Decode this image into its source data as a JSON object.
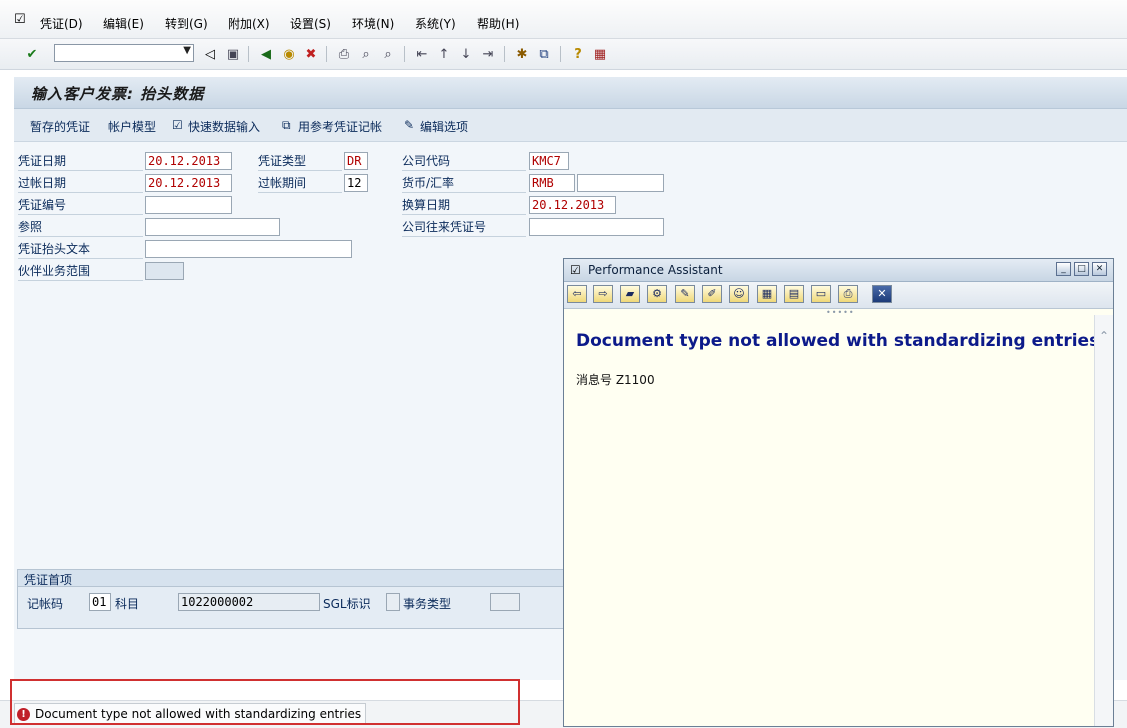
{
  "menu": {
    "items": [
      "凭证(D)",
      "编辑(E)",
      "转到(G)",
      "附加(X)",
      "设置(S)",
      "环境(N)",
      "系统(Y)",
      "帮助(H)"
    ]
  },
  "header": {
    "title": "输入客户发票: 抬头数据"
  },
  "app_toolbar": {
    "parked": "暂存的凭证",
    "acct_model": "帐户模型",
    "fast_entry": "快速数据输入",
    "post_with_ref": "用参考凭证记帐",
    "edit_options": "编辑选项"
  },
  "form": {
    "doc_date": {
      "label": "凭证日期",
      "value": "20.12.2013"
    },
    "post_date": {
      "label": "过帐日期",
      "value": "20.12.2013"
    },
    "doc_no": {
      "label": "凭证编号",
      "value": ""
    },
    "reference": {
      "label": "参照",
      "value": ""
    },
    "header_text": {
      "label": "凭证抬头文本",
      "value": ""
    },
    "partner_ba": {
      "label": "伙伴业务范围",
      "value": ""
    },
    "doc_type": {
      "label": "凭证类型",
      "value": "DR"
    },
    "period": {
      "label": "过帐期间",
      "value": "12"
    },
    "company_code": {
      "label": "公司代码",
      "value": "KMC7"
    },
    "currency": {
      "label": "货币/汇率",
      "value": "RMB",
      "rate": ""
    },
    "translation_date": {
      "label": "换算日期",
      "value": "20.12.2013"
    },
    "intercompany": {
      "label": "公司往来凭证号",
      "value": ""
    }
  },
  "first_item": {
    "title": "凭证首项",
    "posting_key_label": "记帐码",
    "posting_key": "01",
    "account_label": "科目",
    "account": "1022000002",
    "sgl_label": "SGL标识",
    "sgl": "",
    "trans_type_label": "事务类型",
    "trans_type": ""
  },
  "status": {
    "message": "Document type  not allowed with standardizing entries"
  },
  "assistant": {
    "title": "Performance Assistant",
    "heading": "Document type  not allowed with standardizing entries",
    "message_no": "消息号  Z1100"
  }
}
